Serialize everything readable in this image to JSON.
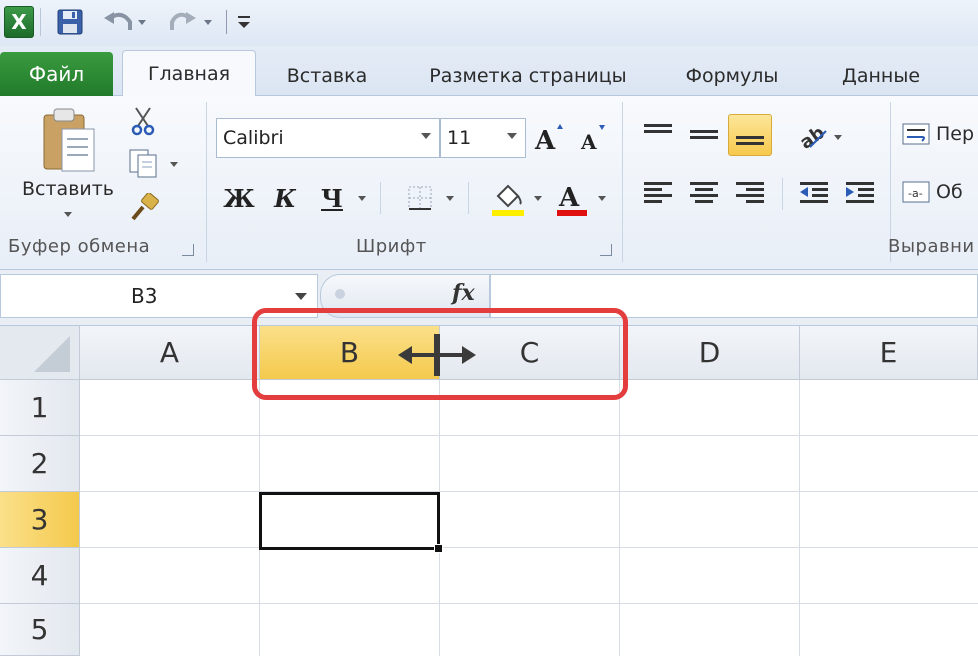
{
  "app": {
    "icon_letter": "X",
    "accent_color": "#217a2a"
  },
  "qat": {
    "icons": [
      "excel-logo-icon",
      "save-icon",
      "undo-icon",
      "redo-icon",
      "customize-qat-icon"
    ]
  },
  "tabs": [
    {
      "label": "Файл",
      "active": false
    },
    {
      "label": "Главная",
      "active": true
    },
    {
      "label": "Вставка",
      "active": false
    },
    {
      "label": "Разметка страницы",
      "active": false
    },
    {
      "label": "Формулы",
      "active": false
    },
    {
      "label": "Данные",
      "active": false
    }
  ],
  "ribbon": {
    "clipboard": {
      "paste_label": "Вставить",
      "group_label": "Буфер обмена"
    },
    "font": {
      "font_name": "Calibri",
      "font_size": "11",
      "bold_label": "Ж",
      "italic_label": "К",
      "underline_label": "Ч",
      "group_label": "Шрифт",
      "fill_color": "#ffee00",
      "font_color": "#e01010"
    },
    "alignment": {
      "wrap_label": "Пер",
      "merge_label": "Об",
      "group_label": "Выравни"
    }
  },
  "formula_bar": {
    "name_box": "B3",
    "fx_label": "fx",
    "formula": ""
  },
  "grid": {
    "columns": [
      "A",
      "B",
      "C",
      "D",
      "E"
    ],
    "rows": [
      "1",
      "2",
      "3",
      "4",
      "5"
    ],
    "selected_column": "B",
    "selected_row": "3",
    "active_cell": "B3",
    "highlight_color": "#e33d3d"
  }
}
